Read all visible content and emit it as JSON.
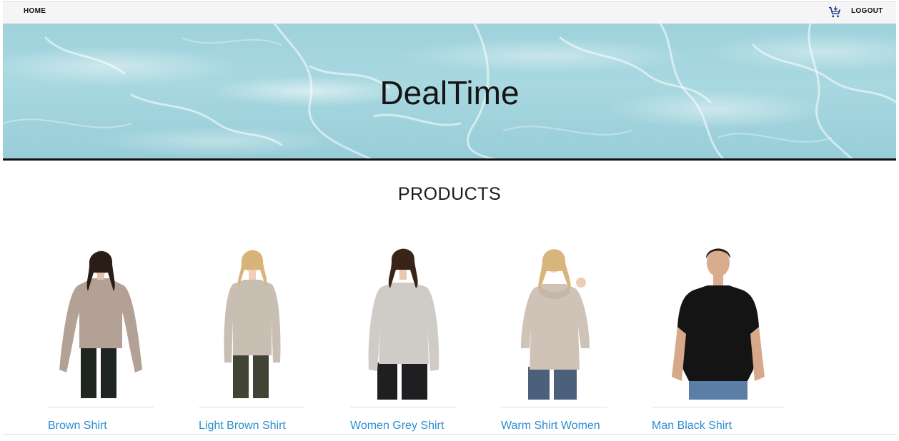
{
  "nav": {
    "home_label": "HOME",
    "logout_label": "LOGOUT",
    "cart_icon": "shopping-cart-icon"
  },
  "hero": {
    "title": "DealTime"
  },
  "products_section": {
    "title": "PRODUCTS"
  },
  "products": [
    {
      "name": "Brown Shirt",
      "top_color": "#b3a196",
      "pants_color": "#1f2622"
    },
    {
      "name": "Light Brown Shirt",
      "top_color": "#c8beb2",
      "pants_color": "#414435"
    },
    {
      "name": "Women Grey Shirt",
      "top_color": "#cfcbc6",
      "pants_color": "#1f1f22"
    },
    {
      "name": "Warm Shirt Women",
      "top_color": "#cfc3b7",
      "pants_color": "#4b607a"
    },
    {
      "name": "Man Black Shirt",
      "top_color": "#141414",
      "pants_color": "#5b7ea6"
    }
  ],
  "colors": {
    "link": "#2b8fd1",
    "nav_bg": "#f5f5f5",
    "hero_water": "#a8d8e0"
  }
}
